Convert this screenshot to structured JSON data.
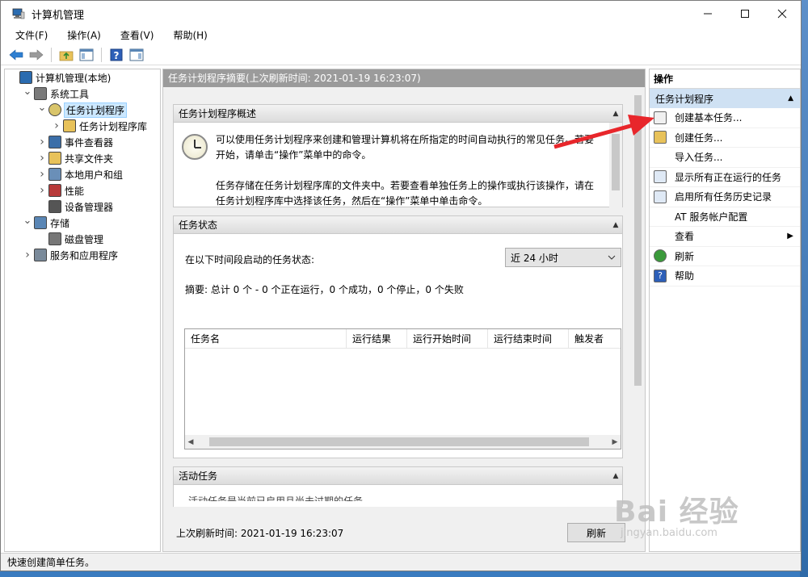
{
  "window": {
    "title": "计算机管理"
  },
  "menu": [
    "文件(F)",
    "操作(A)",
    "查看(V)",
    "帮助(H)"
  ],
  "tree": [
    {
      "label": "计算机管理(本地)",
      "level": 0,
      "tw": "",
      "icon": "computer-icon"
    },
    {
      "label": "系统工具",
      "level": 1,
      "tw": "open",
      "icon": "tools-icon"
    },
    {
      "label": "任务计划程序",
      "level": 2,
      "tw": "open",
      "icon": "clock-icon",
      "selected": true
    },
    {
      "label": "任务计划程序库",
      "level": 3,
      "tw": "closed",
      "icon": "folder-clock-icon"
    },
    {
      "label": "事件查看器",
      "level": 2,
      "tw": "closed",
      "icon": "event-viewer-icon"
    },
    {
      "label": "共享文件夹",
      "level": 2,
      "tw": "closed",
      "icon": "shared-folder-icon"
    },
    {
      "label": "本地用户和组",
      "level": 2,
      "tw": "closed",
      "icon": "users-icon"
    },
    {
      "label": "性能",
      "level": 2,
      "tw": "closed",
      "icon": "performance-icon"
    },
    {
      "label": "设备管理器",
      "level": 2,
      "tw": "",
      "icon": "device-manager-icon"
    },
    {
      "label": "存储",
      "level": 1,
      "tw": "open",
      "icon": "storage-icon"
    },
    {
      "label": "磁盘管理",
      "level": 2,
      "tw": "",
      "icon": "disk-icon"
    },
    {
      "label": "服务和应用程序",
      "level": 1,
      "tw": "closed",
      "icon": "services-icon"
    }
  ],
  "center": {
    "header": "任务计划程序摘要(上次刷新时间: 2021-01-19 16:23:07)",
    "overview": {
      "title": "任务计划程序概述",
      "p1": "可以使用任务计划程序来创建和管理计算机将在所指定的时间自动执行的常见任务。若要开始，请单击“操作”菜单中的命令。",
      "p2": "任务存储在任务计划程序库的文件夹中。若要查看单独任务上的操作或执行该操作，请在任务计划程序库中选择该任务，然后在“操作”菜单中单击命令。"
    },
    "status": {
      "title": "任务状态",
      "period_label": "在以下时间段启动的任务状态:",
      "period_value": "近 24 小时",
      "summary": "摘要: 总计 0 个 - 0 个正在运行，0 个成功，0 个停止，0 个失败",
      "columns": [
        "任务名",
        "运行结果",
        "运行开始时间",
        "运行结束时间",
        "触发者"
      ]
    },
    "active": {
      "title": "活动任务",
      "text": "活动任务是当前已启用且尚未过期的任务。"
    },
    "last_refresh": "上次刷新时间: 2021-01-19 16:23:07",
    "refresh_button": "刷新"
  },
  "actions": {
    "header": "操作",
    "section": "任务计划程序",
    "items": [
      {
        "label": "创建基本任务...",
        "icon": "create-basic-task-icon"
      },
      {
        "label": "创建任务...",
        "icon": "create-task-icon"
      },
      {
        "label": "导入任务...",
        "icon": ""
      },
      {
        "label": "显示所有正在运行的任务",
        "icon": "running-tasks-icon"
      },
      {
        "label": "启用所有任务历史记录",
        "icon": "task-history-icon"
      },
      {
        "label": "AT 服务帐户配置",
        "icon": ""
      },
      {
        "label": "查看",
        "icon": "",
        "submenu": true
      },
      {
        "label": "刷新",
        "icon": "refresh-icon"
      },
      {
        "label": "帮助",
        "icon": "help-icon"
      }
    ]
  },
  "statusbar": "快速创建简单任务。",
  "watermark": {
    "logo": "Bai 经验",
    "url": "jingyan.baidu.com"
  },
  "colors": {
    "accent": "#cfe1f3",
    "selection": "#cce8ff",
    "arrow": "#e8262b",
    "header": "#9b9b9b"
  }
}
